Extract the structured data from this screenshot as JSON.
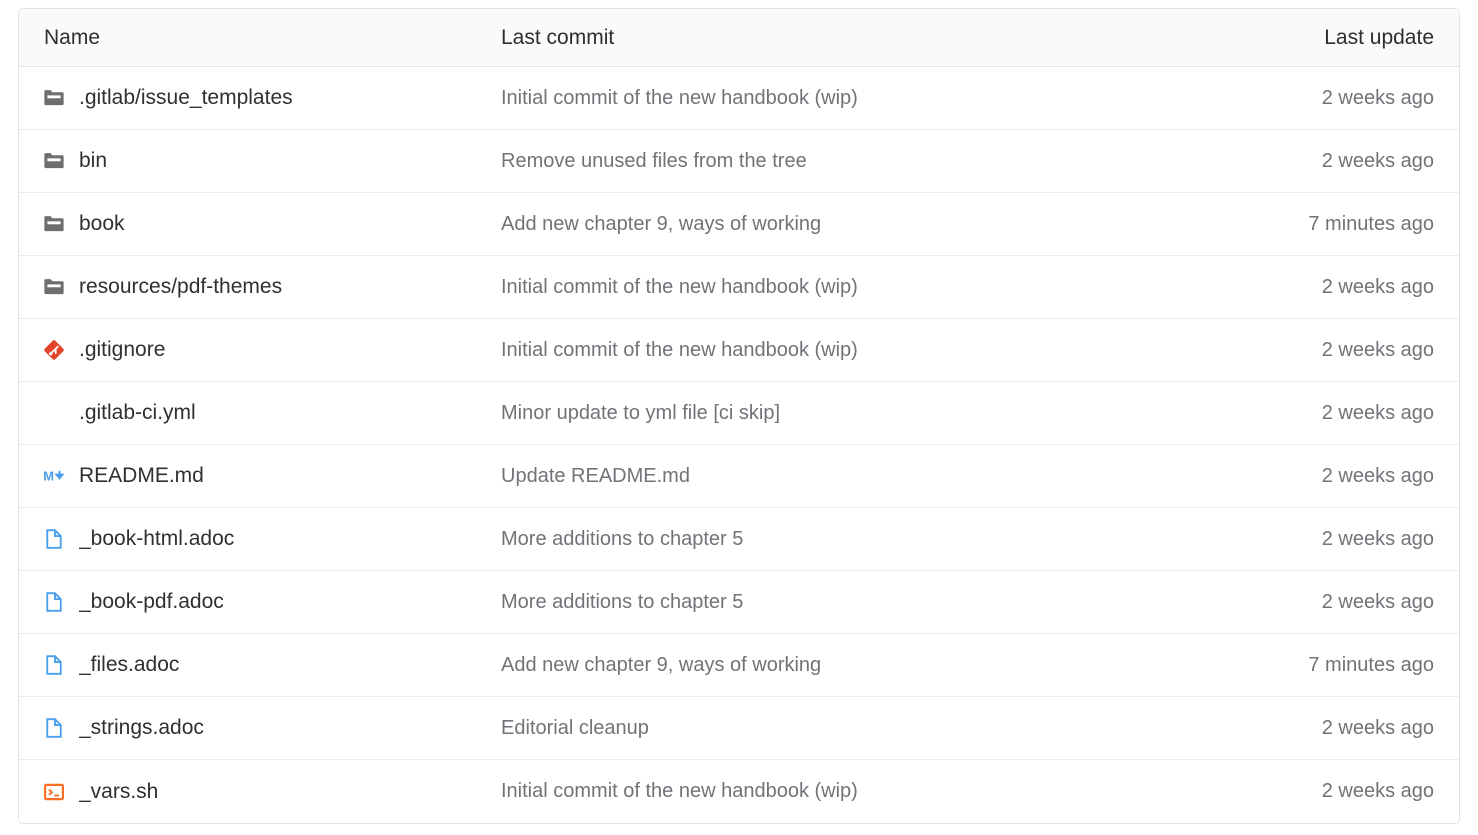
{
  "table": {
    "columns": {
      "name": "Name",
      "last_commit": "Last commit",
      "last_update": "Last update"
    },
    "rows": [
      {
        "icon": "folder-icon",
        "name": ".gitlab/issue_templates",
        "last_commit": "Initial commit of the new handbook (wip)",
        "last_update": "2 weeks ago"
      },
      {
        "icon": "folder-icon",
        "name": "bin",
        "last_commit": "Remove unused files from the tree",
        "last_update": "2 weeks ago"
      },
      {
        "icon": "folder-icon",
        "name": "book",
        "last_commit": "Add new chapter 9, ways of working",
        "last_update": "7 minutes ago"
      },
      {
        "icon": "folder-icon",
        "name": "resources/pdf-themes",
        "last_commit": "Initial commit of the new handbook (wip)",
        "last_update": "2 weeks ago"
      },
      {
        "icon": "git-icon",
        "name": ".gitignore",
        "last_commit": "Initial commit of the new handbook (wip)",
        "last_update": "2 weeks ago"
      },
      {
        "icon": "none",
        "name": ".gitlab-ci.yml",
        "last_commit": "Minor update to yml file [ci skip]",
        "last_update": "2 weeks ago"
      },
      {
        "icon": "markdown-icon",
        "name": "README.md",
        "last_commit": "Update README.md",
        "last_update": "2 weeks ago"
      },
      {
        "icon": "document-icon",
        "name": "_book-html.adoc",
        "last_commit": "More additions to chapter 5",
        "last_update": "2 weeks ago"
      },
      {
        "icon": "document-icon",
        "name": "_book-pdf.adoc",
        "last_commit": "More additions to chapter 5",
        "last_update": "2 weeks ago"
      },
      {
        "icon": "document-icon",
        "name": "_files.adoc",
        "last_commit": "Add new chapter 9, ways of working",
        "last_update": "7 minutes ago"
      },
      {
        "icon": "document-icon",
        "name": "_strings.adoc",
        "last_commit": "Editorial cleanup",
        "last_update": "2 weeks ago"
      },
      {
        "icon": "terminal-icon",
        "name": "_vars.sh",
        "last_commit": "Initial commit of the new handbook (wip)",
        "last_update": "2 weeks ago"
      }
    ]
  },
  "colors": {
    "folder": "#6e6e6e",
    "git": "#e24329",
    "markdown": "#4a9fec",
    "document": "#4a9fec",
    "terminal": "#fc6d26",
    "header_bg": "#fafafa",
    "border": "#e3e3e3",
    "row_divider": "#ececec",
    "name_text": "#303030",
    "muted_text": "#737278"
  }
}
